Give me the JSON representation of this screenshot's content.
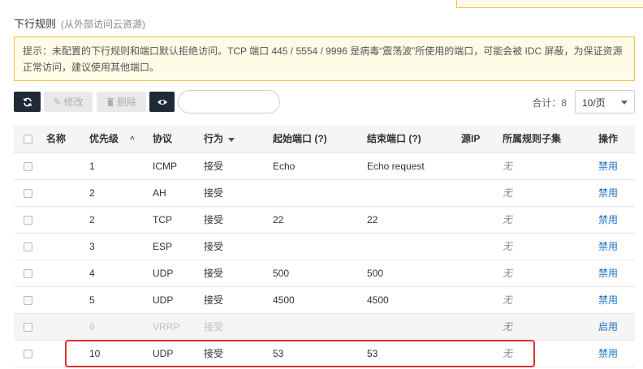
{
  "header": {
    "title": "下行规则",
    "subtitle": "(从外部访问云资源)"
  },
  "notice": {
    "text": "提示：未配置的下行规则和端口默认拒绝访问。TCP 端口 445 / 5554 / 9996 是病毒“震荡波”所使用的端口，可能会被 IDC 屏蔽，为保证资源正常访问，建议使用其他端口。"
  },
  "toolbar": {
    "refresh_icon": "refresh-icon",
    "edit_label": "修改",
    "delete_label": "删除",
    "view_icon": "eye-icon",
    "search_placeholder": "",
    "total_label": "合计：8",
    "page_size": "10/页"
  },
  "table": {
    "headers": {
      "name": "名称",
      "priority": "优先级",
      "protocol": "协议",
      "action": "行为",
      "start_port": "起始端口 (?)",
      "end_port": "结束端口 (?)",
      "source_ip": "源IP",
      "rule_subset": "所属规则子集",
      "operation": "操作"
    },
    "rows": [
      {
        "name": "",
        "priority": "1",
        "protocol": "ICMP",
        "action": "接受",
        "start_port": "Echo",
        "end_port": "Echo request",
        "source_ip": "",
        "rule_subset": "无",
        "operation": "禁用"
      },
      {
        "name": "",
        "priority": "2",
        "protocol": "AH",
        "action": "接受",
        "start_port": "",
        "end_port": "",
        "source_ip": "",
        "rule_subset": "无",
        "operation": "禁用"
      },
      {
        "name": "",
        "priority": "2",
        "protocol": "TCP",
        "action": "接受",
        "start_port": "22",
        "end_port": "22",
        "source_ip": "",
        "rule_subset": "无",
        "operation": "禁用"
      },
      {
        "name": "",
        "priority": "3",
        "protocol": "ESP",
        "action": "接受",
        "start_port": "",
        "end_port": "",
        "source_ip": "",
        "rule_subset": "无",
        "operation": "禁用"
      },
      {
        "name": "",
        "priority": "4",
        "protocol": "UDP",
        "action": "接受",
        "start_port": "500",
        "end_port": "500",
        "source_ip": "",
        "rule_subset": "无",
        "operation": "禁用"
      },
      {
        "name": "",
        "priority": "5",
        "protocol": "UDP",
        "action": "接受",
        "start_port": "4500",
        "end_port": "4500",
        "source_ip": "",
        "rule_subset": "无",
        "operation": "禁用"
      },
      {
        "name": "",
        "priority": "6",
        "protocol": "VRRP",
        "action": "接受",
        "start_port": "",
        "end_port": "",
        "source_ip": "",
        "rule_subset": "无",
        "operation": "启用"
      },
      {
        "name": "",
        "priority": "10",
        "protocol": "UDP",
        "action": "接受",
        "start_port": "53",
        "end_port": "53",
        "source_ip": "",
        "rule_subset": "无",
        "operation": "禁用"
      }
    ]
  },
  "colors": {
    "accent": "#1a73c8",
    "dark_button": "#1f2a36",
    "notice_border": "#f0c040",
    "notice_bg": "#fffbe6",
    "highlight": "#e62e2e"
  }
}
